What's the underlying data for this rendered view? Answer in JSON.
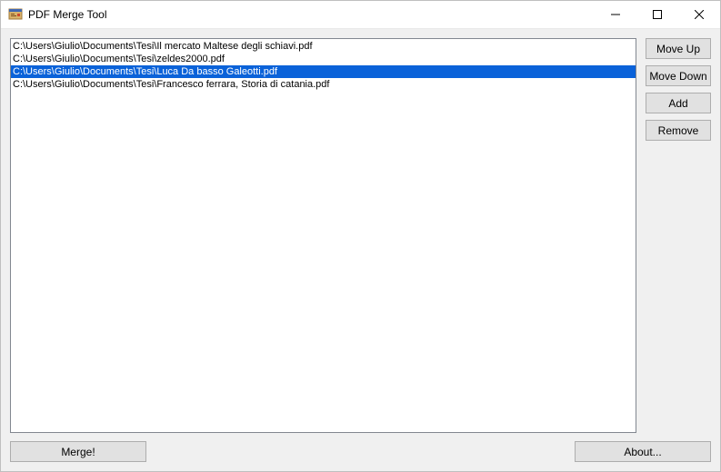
{
  "window": {
    "title": "PDF Merge Tool"
  },
  "files": [
    {
      "path": "C:\\Users\\Giulio\\Documents\\Tesi\\Il mercato Maltese degli schiavi.pdf",
      "selected": false
    },
    {
      "path": "C:\\Users\\Giulio\\Documents\\Tesi\\zeldes2000.pdf",
      "selected": false
    },
    {
      "path": "C:\\Users\\Giulio\\Documents\\Tesi\\Luca Da basso Galeotti.pdf",
      "selected": true
    },
    {
      "path": "C:\\Users\\Giulio\\Documents\\Tesi\\Francesco ferrara, Storia di catania.pdf",
      "selected": false
    }
  ],
  "buttons": {
    "move_up": "Move Up",
    "move_down": "Move Down",
    "add": "Add",
    "remove": "Remove",
    "merge": "Merge!",
    "about": "About..."
  }
}
